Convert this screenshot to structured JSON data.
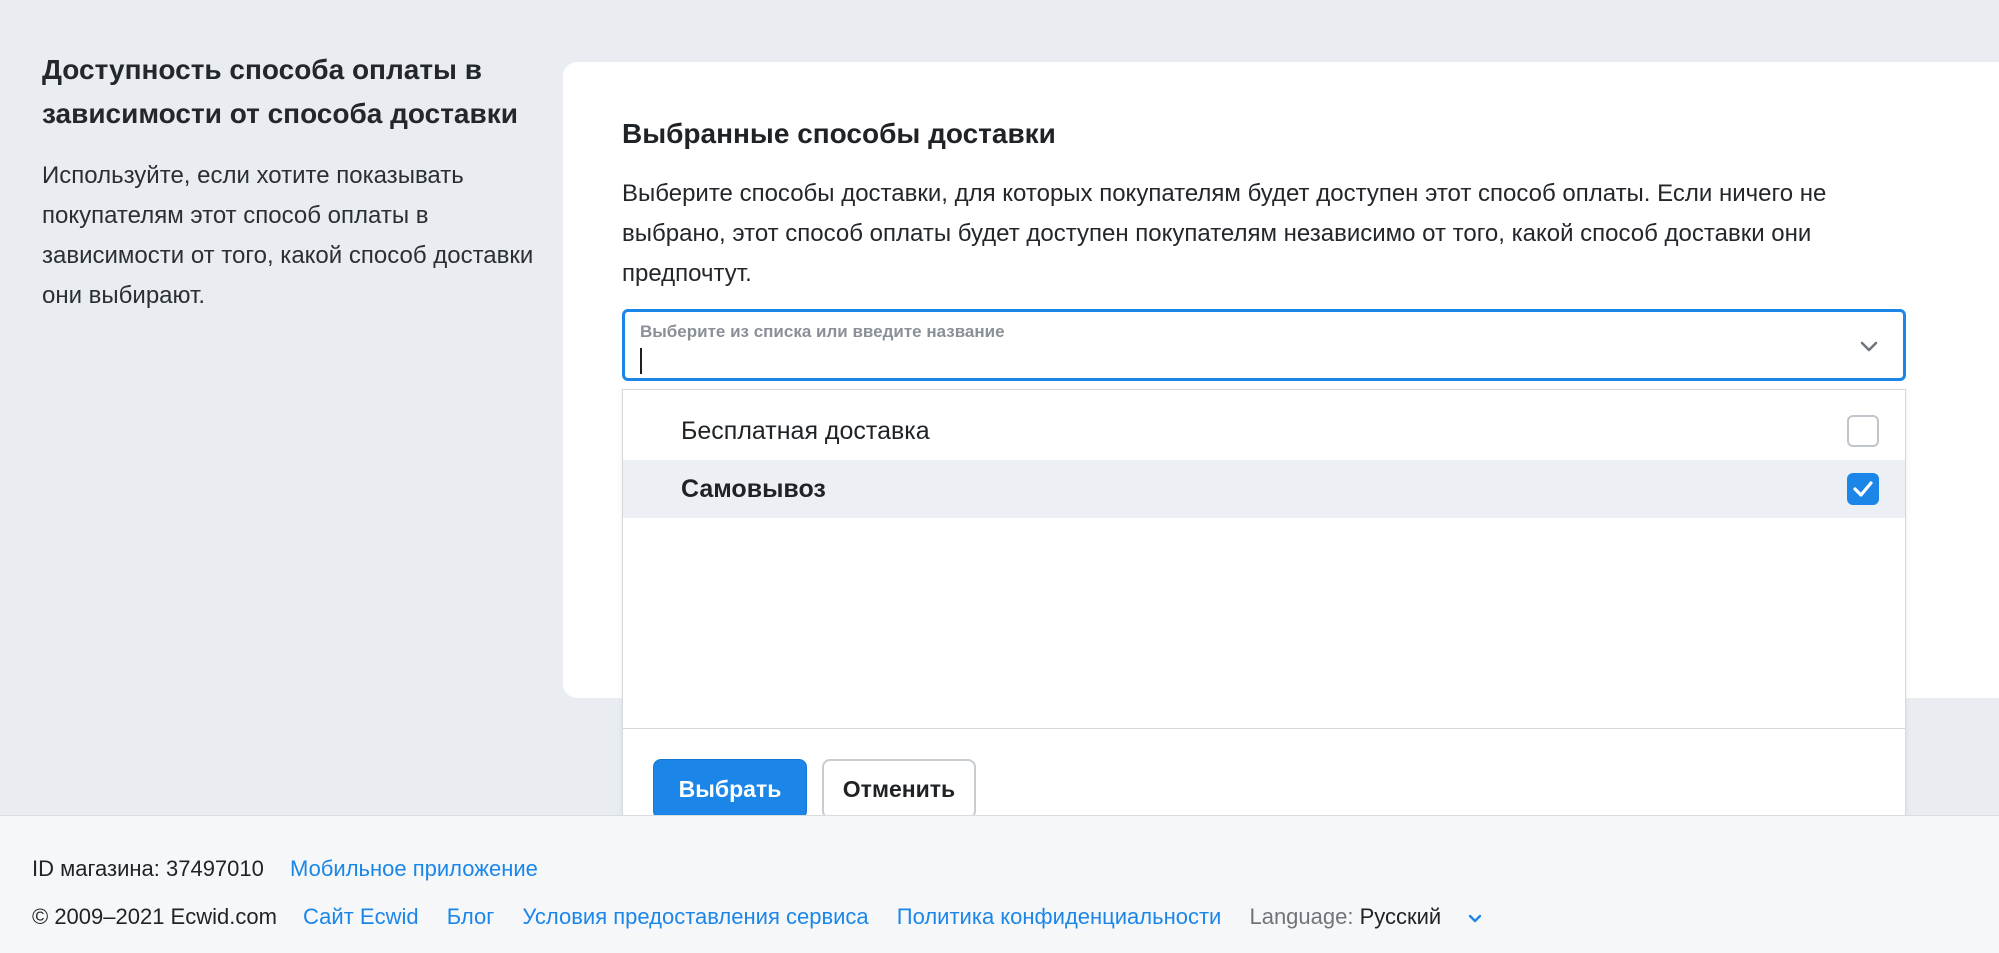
{
  "side": {
    "title": "Доступность способа оплаты в зависимости от способа доставки",
    "description": "Используйте, если хотите показывать покупателям этот способ оплаты в зависимости от того, какой способ доставки они выбирают."
  },
  "card": {
    "title": "Выбранные способы доставки",
    "description": "Выберите способы доставки, для которых покупателям будет доступен этот способ оплаты. Если ничего не выбрано, этот способ оплаты будет доступен покупателям независимо от того, какой способ доставки они предпочтут."
  },
  "select": {
    "label": "Выберите из списка или введите название",
    "value": ""
  },
  "options": [
    {
      "label": "Бесплатная доставка",
      "checked": false
    },
    {
      "label": "Самовывоз",
      "checked": true
    }
  ],
  "buttons": {
    "confirm": "Выбрать",
    "cancel": "Отменить"
  },
  "footer": {
    "store_id": "ID магазина: 37497010",
    "mobile_app": "Мобильное приложение",
    "copyright": "© 2009–2021 Ecwid.com",
    "links": [
      "Сайт Ecwid",
      "Блог",
      "Условия предоставления сервиса",
      "Политика конфиденциальности"
    ],
    "language_label": "Language:",
    "language_value": "Русский"
  },
  "colors": {
    "accent": "#1b86e8",
    "background": "#e9edf1"
  }
}
